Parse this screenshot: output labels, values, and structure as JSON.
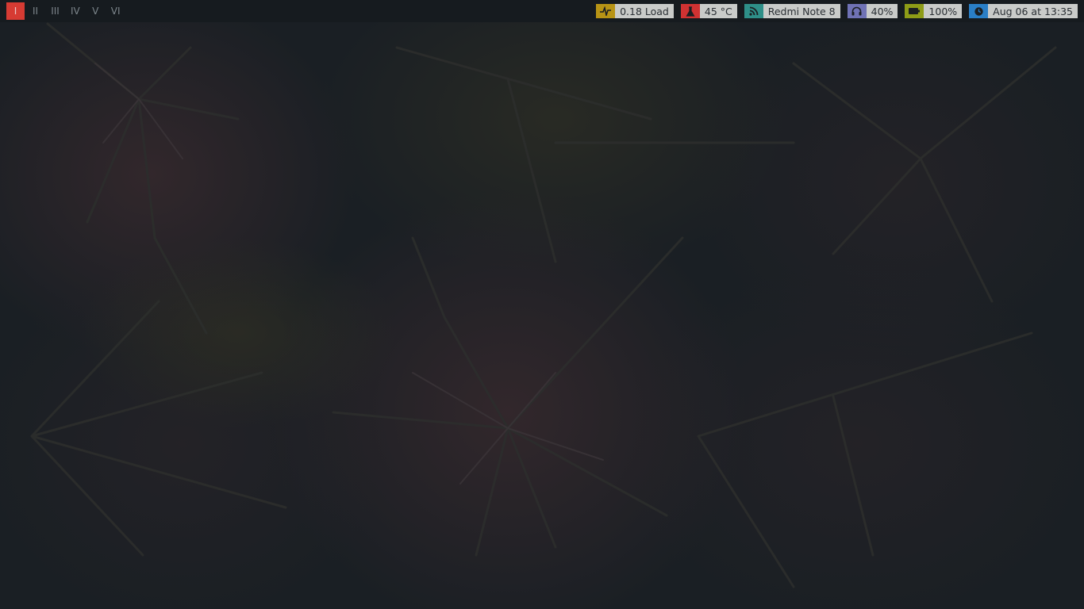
{
  "colors": {
    "bar_bg": "#161b1f",
    "desktop_bg": "#1a1f24",
    "active_workspace": "#d63b33",
    "module_text_bg": "#c9cbc9",
    "load_accent": "#b89415",
    "temp_accent": "#d13232",
    "network_accent": "#2e8f88",
    "volume_accent": "#6f72b5",
    "battery_accent": "#8e9c17",
    "clock_accent": "#2a7fc7"
  },
  "workspaces": [
    {
      "label": "I",
      "active": true
    },
    {
      "label": "II",
      "active": false
    },
    {
      "label": "III",
      "active": false
    },
    {
      "label": "IV",
      "active": false
    },
    {
      "label": "V",
      "active": false
    },
    {
      "label": "VI",
      "active": false
    }
  ],
  "modules": {
    "load": {
      "icon": "pulse-icon",
      "text": "0.18 Load"
    },
    "temperature": {
      "icon": "thermometer-icon",
      "text": "45 °C"
    },
    "network": {
      "icon": "wifi-icon",
      "text": "Redmi Note 8"
    },
    "volume": {
      "icon": "headphones-icon",
      "text": "40%"
    },
    "battery": {
      "icon": "battery-icon",
      "text": "100%"
    },
    "clock": {
      "icon": "clock-icon",
      "text": "Aug 06 at 13:35"
    }
  }
}
